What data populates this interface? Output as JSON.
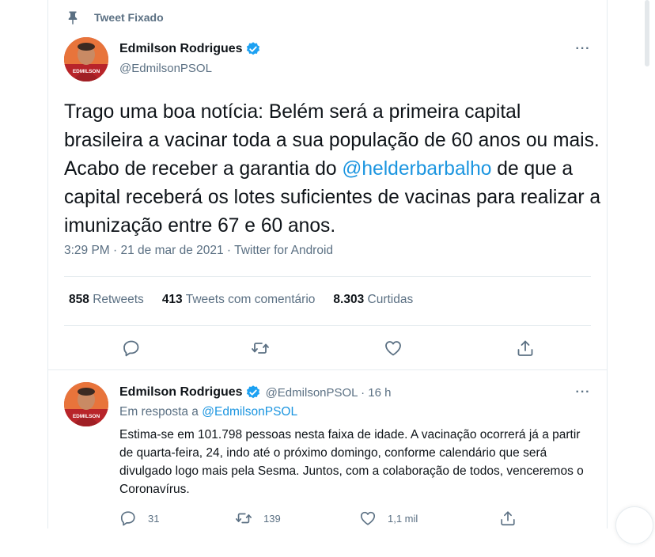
{
  "pinned": {
    "label": "Tweet Fixado",
    "icon": "pin-icon"
  },
  "tweet": {
    "author": {
      "name": "Edmilson Rodrigues",
      "handle": "@EdmilsonPSOL",
      "verified": true,
      "avatar_text": "EDMILSON"
    },
    "text_before": "Trago uma boa notícia: Belém será a primeira capital brasileira a vacinar toda a sua população de 60 anos ou mais. Acabo de receber a garantia do ",
    "mention": "@helderbarbalho",
    "text_after": " de que a capital receberá os lotes suficientes de vacinas para realizar a imunização entre 67 e 60 anos.",
    "meta": "3:29 PM · 21 de mar de 2021 · Twitter for Android",
    "stats": {
      "retweets_count": "858",
      "retweets_label": "Retweets",
      "comments_count": "413",
      "comments_label": "Tweets com comentário",
      "likes_count": "8.303",
      "likes_label": "Curtidas"
    },
    "more_label": "···"
  },
  "reply": {
    "author": {
      "name": "Edmilson Rodrigues",
      "handle_time": "@EdmilsonPSOL · 16 h",
      "avatar_text": "EDMILSON"
    },
    "reply_to_prefix": "Em resposta a ",
    "reply_to_handle": "@EdmilsonPSOL",
    "text": "Estima-se em 101.798 pessoas nesta faixa de idade. A vacinação ocorrerá já a partir de quarta-feira, 24, indo até o próximo domingo, conforme calendário que será divulgado logo mais pela Sesma. Juntos, com a colaboração de todos, venceremos o Coronavírus.",
    "replies": "31",
    "retweets": "139",
    "likes": "1,1 mil",
    "more_label": "···"
  },
  "colors": {
    "accent": "#1b95e0",
    "verified": "#1da1f2",
    "muted": "#5b7083",
    "text": "#0f1419",
    "border": "#e6ecf0"
  }
}
